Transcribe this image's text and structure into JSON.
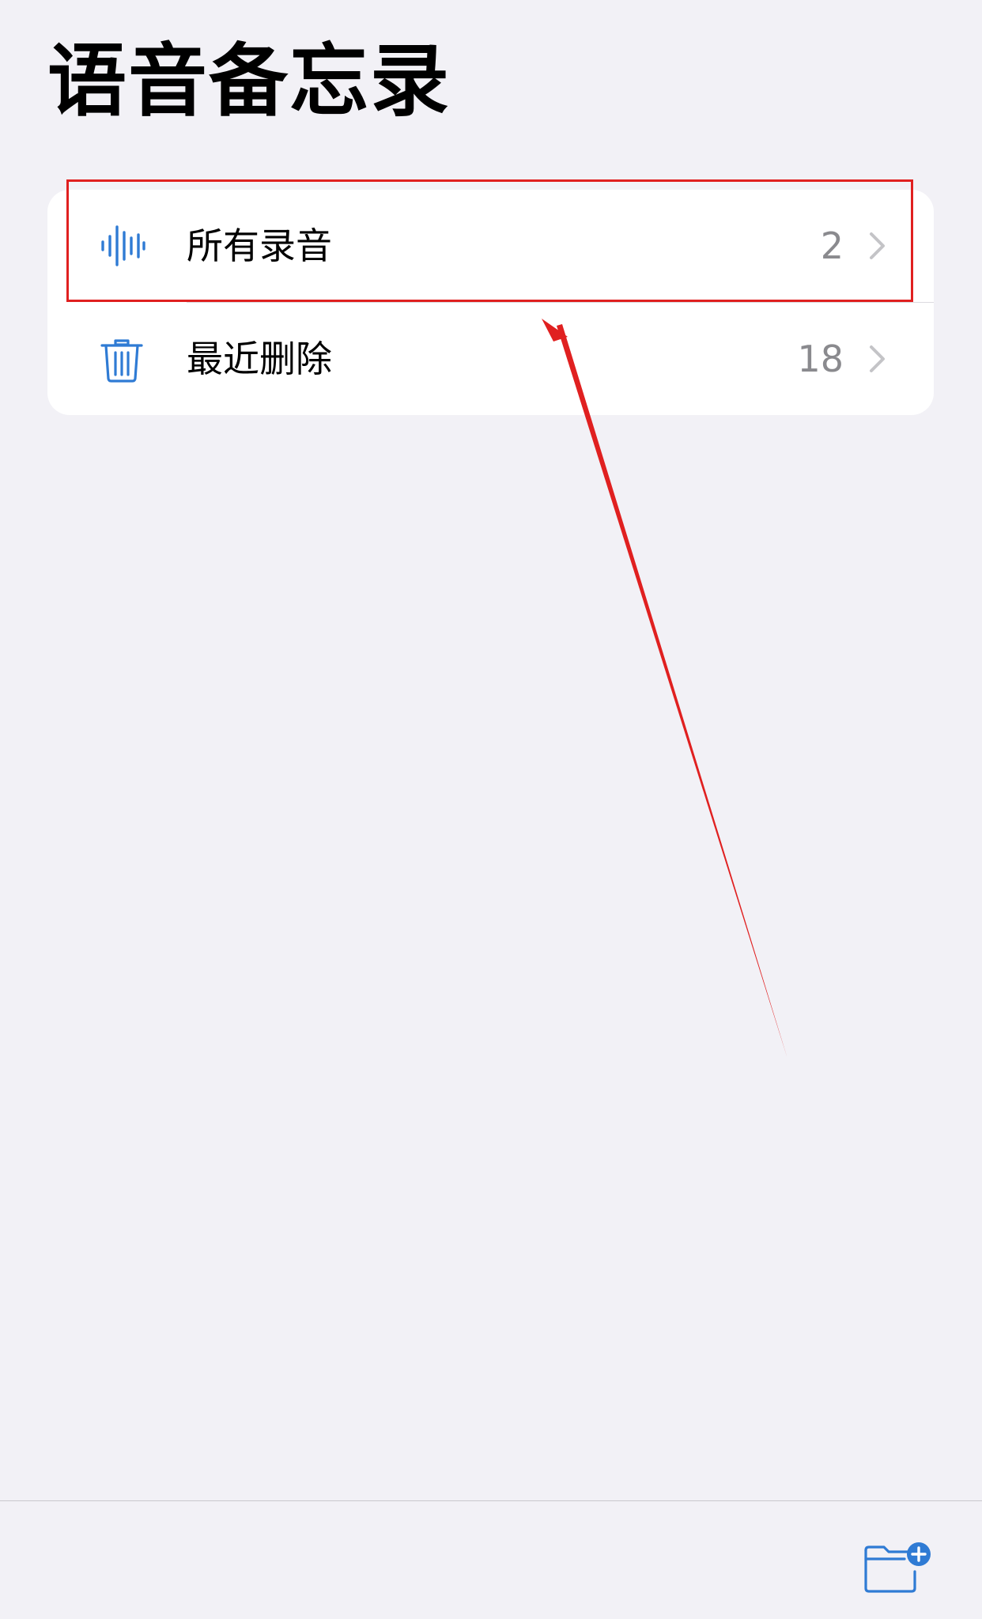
{
  "page": {
    "title": "语音备忘录"
  },
  "list": {
    "items": [
      {
        "label": "所有录音",
        "count": "2",
        "icon": "waveform-icon"
      },
      {
        "label": "最近删除",
        "count": "18",
        "icon": "trash-icon"
      }
    ]
  },
  "toolbar": {
    "new_folder_icon": "new-folder-icon"
  },
  "colors": {
    "background": "#F2F1F6",
    "card": "#FFFFFF",
    "accent_blue": "#2F7BD4",
    "secondary_text": "#8A8A8E",
    "chevron": "#C4C4C7",
    "annotation_red": "#E02020"
  }
}
